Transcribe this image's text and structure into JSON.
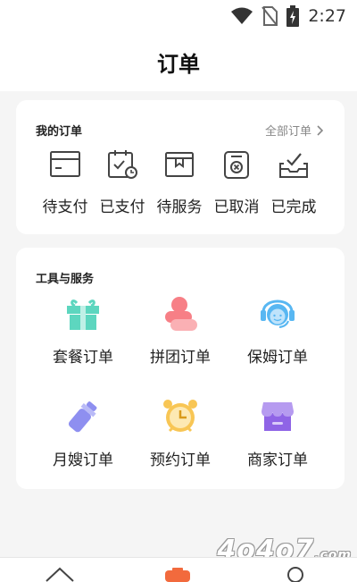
{
  "status_bar": {
    "time": "2:27",
    "icons": [
      "wifi-icon",
      "no-sim-icon",
      "battery-charging-icon"
    ]
  },
  "header": {
    "title": "订单"
  },
  "my_orders": {
    "title": "我的订单",
    "all_orders_label": "全部订单",
    "items": [
      {
        "label": "待支付",
        "icon": "card-icon"
      },
      {
        "label": "已支付",
        "icon": "paid-clipboard-icon"
      },
      {
        "label": "待服务",
        "icon": "box-icon"
      },
      {
        "label": "已取消",
        "icon": "cancel-icon"
      },
      {
        "label": "已完成",
        "icon": "completed-tray-icon"
      }
    ]
  },
  "tools": {
    "title": "工具与服务",
    "items": [
      {
        "label": "套餐订单",
        "icon": "gift-icon",
        "color": "#5dd6bf"
      },
      {
        "label": "拼团订单",
        "icon": "group-icon",
        "color": "#f77f86"
      },
      {
        "label": "保姆订单",
        "icon": "nanny-icon",
        "color": "#58b7f2"
      },
      {
        "label": "月嫂订单",
        "icon": "baby-bottle-icon",
        "color": "#8e8ff0"
      },
      {
        "label": "预约订单",
        "icon": "alarm-clock-icon",
        "color": "#f8c655"
      },
      {
        "label": "商家订单",
        "icon": "shop-icon",
        "color": "#8f64e6"
      }
    ]
  },
  "bottom_nav": {
    "icons": [
      "home-icon",
      "orders-icon",
      "profile-icon"
    ],
    "active_color": "#f26a3d"
  },
  "watermark": {
    "text": "4o4o7",
    "suffix": ".com"
  }
}
